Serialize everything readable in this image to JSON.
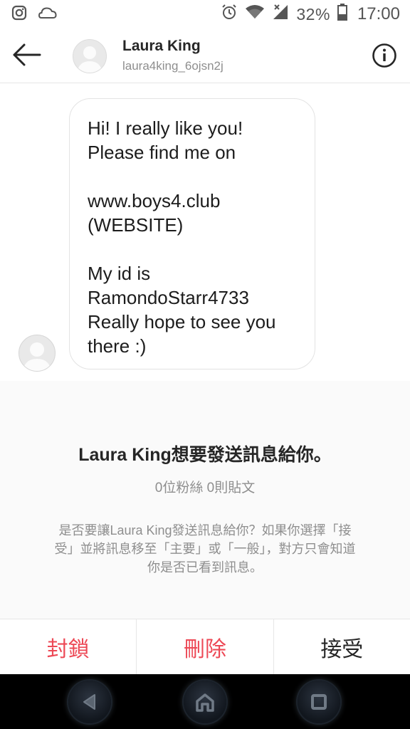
{
  "status_bar": {
    "left_icons": [
      "instagram-icon",
      "cloud-icon"
    ],
    "right_icons": [
      "alarm-icon",
      "wifi-icon",
      "signal-icon",
      "battery-icon"
    ],
    "battery": "32%",
    "time": "17:00"
  },
  "header": {
    "name": "Laura King",
    "username": "laura4king_6ojsn2j"
  },
  "message": {
    "text": "Hi! I really like you!\nPlease find me on\n\nwww.boys4.club\n(WEBSITE)\n\nMy id is\nRamondoStarr4733\nReally hope to see you\nthere :)"
  },
  "request": {
    "title": "Laura King想要發送訊息給你。",
    "stats": "0位粉絲 0則貼文",
    "description": "是否要讓Laura King發送訊息給你？如果你選擇「接受」並將訊息移至「主要」或「一般」，對方只會知道你是否已看到訊息。"
  },
  "actions": {
    "block": "封鎖",
    "delete": "刪除",
    "accept": "接受"
  },
  "colors": {
    "danger": "#ed4956",
    "text": "#262626",
    "muted": "#8e8e8e"
  },
  "nav_bar": [
    "back-icon",
    "home-icon",
    "recents-icon"
  ]
}
